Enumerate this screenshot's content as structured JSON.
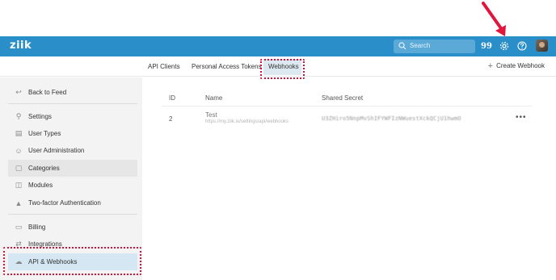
{
  "header": {
    "logo": "ziik",
    "search_placeholder": "Search",
    "icons": [
      "search-icon",
      "quotes-icon",
      "gear-icon",
      "help-icon",
      "avatar"
    ],
    "brand_color": "#2a8fc9"
  },
  "tabs": {
    "items": [
      "API Clients",
      "Personal Access Tokens",
      "Webhooks"
    ],
    "active": "Webhooks",
    "create_label": "Create Webhook"
  },
  "sidebar": {
    "back": "Back to Feed",
    "items": [
      {
        "label": "Settings",
        "icon": "wrench-icon"
      },
      {
        "label": "User Types",
        "icon": "id-card-icon"
      },
      {
        "label": "User Administration",
        "icon": "user-icon"
      },
      {
        "label": "Categories",
        "icon": "folder-icon"
      },
      {
        "label": "Modules",
        "icon": "puzzle-icon"
      },
      {
        "label": "Two-factor Authentication",
        "icon": "lock-icon"
      },
      {
        "label": "Billing",
        "icon": "credit-card-icon"
      },
      {
        "label": "Integrations",
        "icon": "arrows-icon"
      },
      {
        "label": "API & Webhooks",
        "icon": "cloud-icon"
      }
    ],
    "selected": "API & Webhooks"
  },
  "table": {
    "columns": [
      "ID",
      "Name",
      "Shared Secret"
    ],
    "rows": [
      {
        "id": "2",
        "name": "Test",
        "url": "https://my.ziik.io/settings/api/webhooks",
        "secret": "U3ZHiro5NnpMvShIFYWFIzNWuestXckQCjU1hwmO",
        "more": "•••"
      }
    ]
  },
  "annotation_color": "#d2123a"
}
